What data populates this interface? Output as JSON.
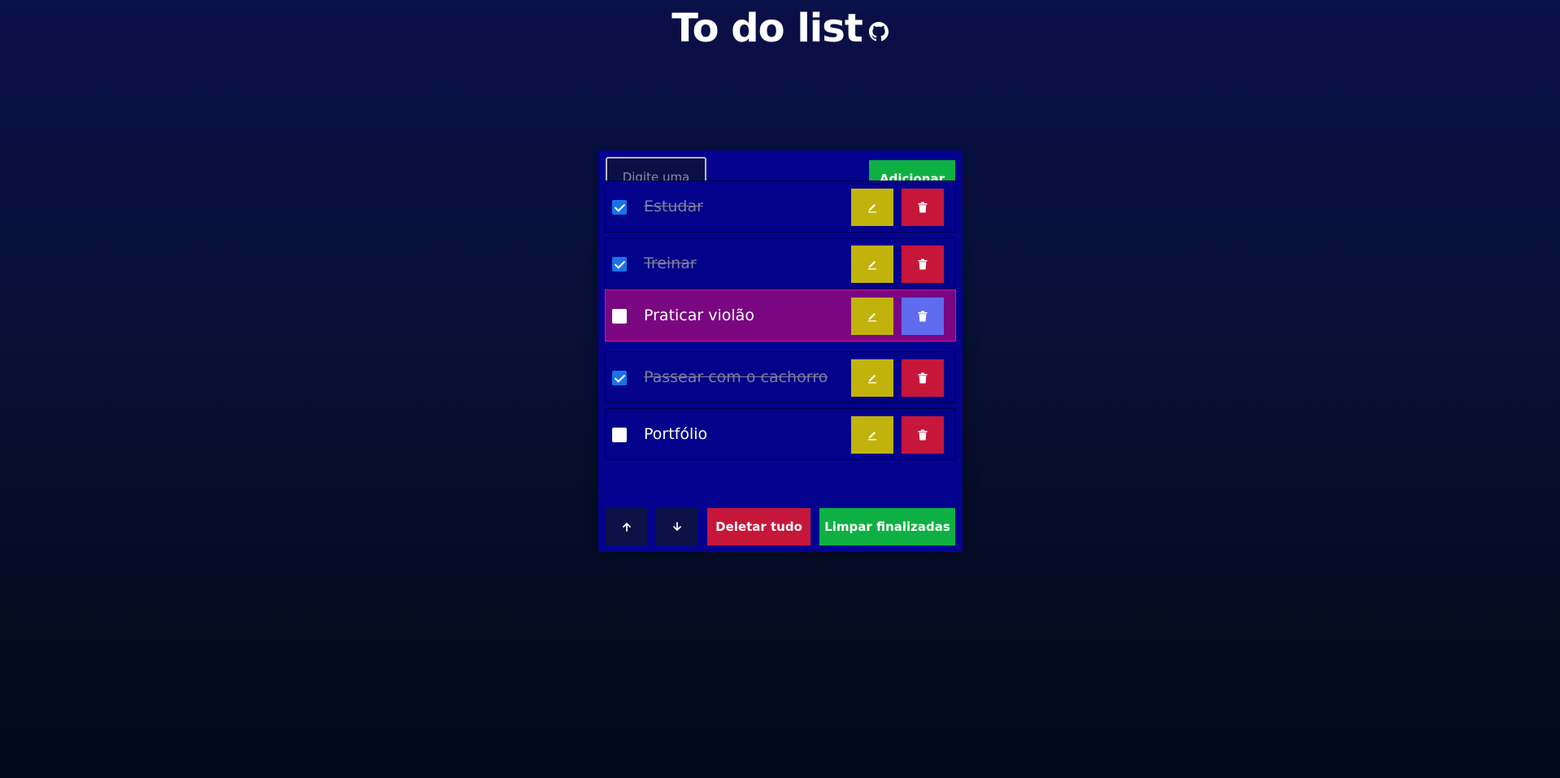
{
  "header": {
    "title": "To do list",
    "github_icon": "github-icon"
  },
  "form": {
    "input_placeholder": "Digite uma",
    "input_value": "",
    "add_label": "Adicionar"
  },
  "tasks": [
    {
      "text": "Estudar",
      "done": true
    },
    {
      "text": "Treinar",
      "done": true
    },
    {
      "text": "Praticar violão",
      "done": false,
      "hovered": true
    },
    {
      "text": "Passear com o cachorro",
      "done": true
    },
    {
      "text": "Portfólio",
      "done": false
    }
  ],
  "icons": {
    "edit": "pencil-icon",
    "delete": "trash-icon",
    "move_up": "arrow-up-icon",
    "move_down": "arrow-down-icon"
  },
  "footer": {
    "delete_all_label": "Deletar tudo",
    "clear_done_label": "Limpar finalizadas"
  },
  "colors": {
    "card_bg": "#03038f",
    "add_green": "#0fb043",
    "edit_yellow": "#c1b30b",
    "delete_red": "#c6173a",
    "hover_purple": "#7a0682",
    "hover_delete_blue": "#5f6cf0",
    "checkbox_blue": "#1a72e8"
  }
}
